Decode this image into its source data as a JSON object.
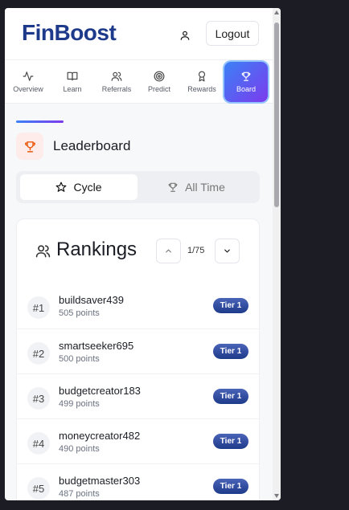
{
  "header": {
    "logo": "FinBoost",
    "logout_label": "Logout"
  },
  "nav": [
    {
      "label": "Overview",
      "icon": "activity-icon"
    },
    {
      "label": "Learn",
      "icon": "book-icon"
    },
    {
      "label": "Referrals",
      "icon": "users-icon"
    },
    {
      "label": "Predict",
      "icon": "target-icon"
    },
    {
      "label": "Rewards",
      "icon": "award-icon"
    },
    {
      "label": "Board",
      "icon": "trophy-icon",
      "active": true
    }
  ],
  "leaderboard": {
    "title": "Leaderboard",
    "tabs": [
      {
        "label": "Cycle",
        "active": true
      },
      {
        "label": "All Time"
      }
    ],
    "rankings_title": "Rankings",
    "page": "1/75",
    "rows": [
      {
        "rank": "#1",
        "name": "buildsaver439",
        "points": "505 points",
        "tier": "Tier 1"
      },
      {
        "rank": "#2",
        "name": "smartseeker695",
        "points": "500 points",
        "tier": "Tier 1"
      },
      {
        "rank": "#3",
        "name": "budgetcreator183",
        "points": "499 points",
        "tier": "Tier 1"
      },
      {
        "rank": "#4",
        "name": "moneycreator482",
        "points": "490 points",
        "tier": "Tier 1"
      },
      {
        "rank": "#5",
        "name": "budgetmaster303",
        "points": "487 points",
        "tier": "Tier 1"
      }
    ]
  },
  "colors": {
    "brand": "#1e3a8a",
    "accent_start": "#3b82f6",
    "accent_end": "#7c3aed",
    "trophy": "#ea580c"
  }
}
